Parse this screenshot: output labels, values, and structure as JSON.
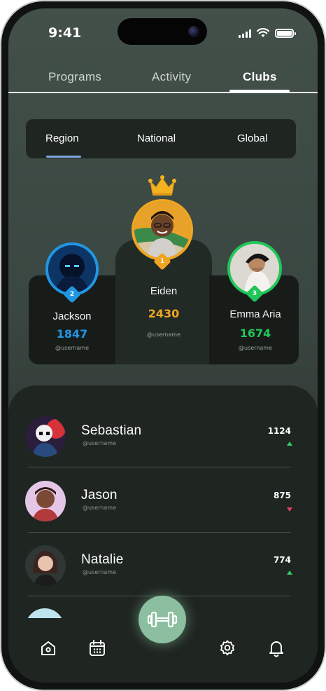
{
  "status_bar": {
    "time": "9:41"
  },
  "top_tabs": [
    {
      "label": "Programs",
      "active": false
    },
    {
      "label": "Activity",
      "active": false
    },
    {
      "label": "Clubs",
      "active": true
    }
  ],
  "segment": [
    {
      "label": "Region",
      "active": true
    },
    {
      "label": "National",
      "active": false
    },
    {
      "label": "Global",
      "active": false
    }
  ],
  "podium": {
    "first": {
      "rank": "1",
      "name": "Eiden",
      "score": "2430",
      "username": "@username",
      "color": "#f0a522"
    },
    "second": {
      "rank": "2",
      "name": "Jackson",
      "score": "1847",
      "username": "@username",
      "color": "#2196e3"
    },
    "third": {
      "rank": "3",
      "name": "Emma Aria",
      "score": "1674",
      "username": "@username",
      "color": "#21c65a"
    }
  },
  "leaderboard": [
    {
      "name": "Sebastian",
      "username": "@username",
      "score": "1124",
      "trend": "up"
    },
    {
      "name": "Jason",
      "username": "@username",
      "score": "875",
      "trend": "down"
    },
    {
      "name": "Natalie",
      "username": "@username",
      "score": "774",
      "trend": "up"
    }
  ],
  "bottom_nav": {
    "items": [
      "home-icon",
      "calendar-icon",
      "dumbbell-icon",
      "settings-icon",
      "bell-icon"
    ],
    "fab_color": "#8bbf9f"
  },
  "colors": {
    "up": "#35c96b",
    "down": "#e0415e",
    "gold": "#f0a522",
    "blue": "#2196e3",
    "green": "#21c65a",
    "segment_indicator": "#7ea2e0"
  }
}
